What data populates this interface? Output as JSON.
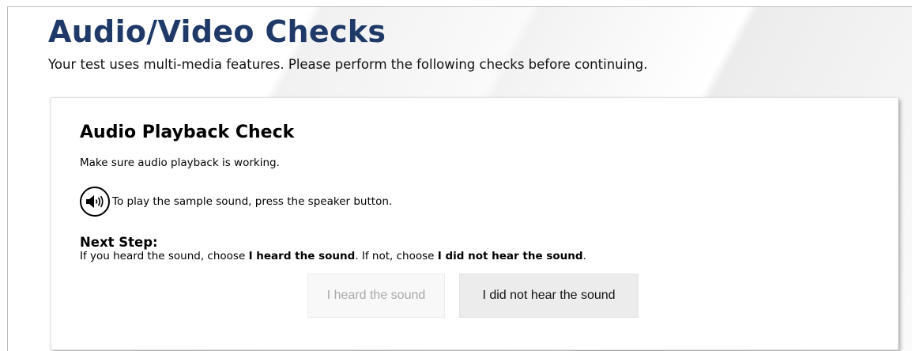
{
  "page": {
    "title": "Audio/Video Checks",
    "subtitle": "Your test uses multi-media features. Please perform the following checks before continuing."
  },
  "audio_check": {
    "title": "Audio Playback Check",
    "description": "Make sure audio playback is working.",
    "speaker_icon": "speaker-volume-icon",
    "speaker_instruction": "To play the sample sound, press the speaker button.",
    "next_step_title": "Next Step:",
    "next_step_text": {
      "prefix": "If you heard the sound, choose ",
      "heard_emphasis": "I heard the sound",
      "middle": ". If not, choose ",
      "not_heard_emphasis": "I did not hear the sound",
      "suffix": "."
    },
    "buttons": {
      "heard_label": "I heard the sound",
      "heard_state": "disabled",
      "not_heard_label": "I did not hear the sound"
    }
  },
  "colors": {
    "title": "#1f3a68",
    "heard_button_text": "#a9a9a9",
    "not_heard_button_bg": "#ececec"
  }
}
